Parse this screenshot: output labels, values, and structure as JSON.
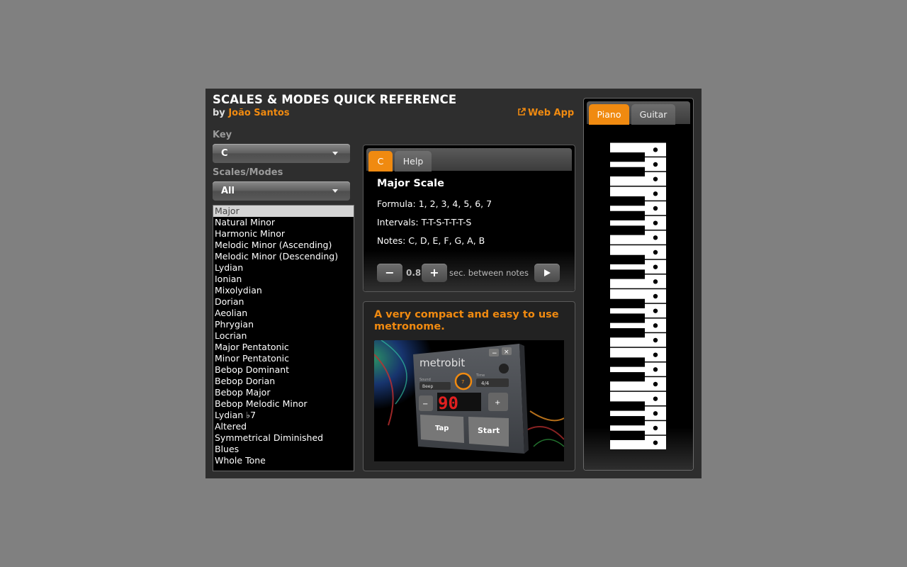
{
  "header": {
    "title": "SCALES & MODES QUICK REFERENCE",
    "by": "by",
    "author": "João Santos",
    "web_app": "Web App"
  },
  "key": {
    "label": "Key",
    "value": "C"
  },
  "scales": {
    "label": "Scales/Modes",
    "filter": "All",
    "selected": "Major",
    "items": [
      "Major",
      "Natural Minor",
      "Harmonic Minor",
      "Melodic Minor (Ascending)",
      "Melodic Minor (Descending)",
      "Lydian",
      "Ionian",
      "Mixolydian",
      "Dorian",
      "Aeolian",
      "Phrygian",
      "Locrian",
      "Major Pentatonic",
      "Minor Pentatonic",
      "Bebop Dominant",
      "Bebop Dorian",
      "Bebop Major",
      "Bebop Melodic Minor",
      "Lydian ♭7",
      "Altered",
      "Symmetrical Diminished",
      "Blues",
      "Whole Tone"
    ]
  },
  "info_panel": {
    "tabs": [
      "C",
      "Help"
    ],
    "active_tab": "C",
    "scale_name": "Major Scale",
    "formula": "Formula: 1, 2, 3, 4, 5, 6, 7",
    "intervals": "Intervals: T-T-S-T-T-T-S",
    "notes": "Notes: C, D, E, F, G, A, B",
    "speed": "0.8",
    "speed_label": "sec. between notes",
    "minus": "−",
    "plus": "+",
    "play_icon": "play-icon"
  },
  "ad": {
    "text": "A very compact and easy to use metronome.",
    "brand": "metrobit",
    "sound_label": "Sound",
    "sound_value": "Beep",
    "time_label": "Time",
    "time_value": "4/4",
    "knob_value": "7",
    "bpm": "90",
    "minus": "−",
    "plus": "+",
    "tap": "Tap",
    "start": "Start",
    "min_btn": "−",
    "close_btn": "×"
  },
  "instrument": {
    "tabs": [
      "Piano",
      "Guitar"
    ],
    "active_tab": "Piano",
    "white_keys": 21,
    "black_keys_after_white": [
      0,
      1,
      3,
      4,
      5,
      7,
      8,
      10,
      11,
      12,
      14,
      15,
      17,
      18,
      19
    ],
    "highlighted": "every white key"
  },
  "colors": {
    "accent": "#f08a10",
    "app_bg": "#2e2e2e",
    "page_bg": "#808080"
  }
}
